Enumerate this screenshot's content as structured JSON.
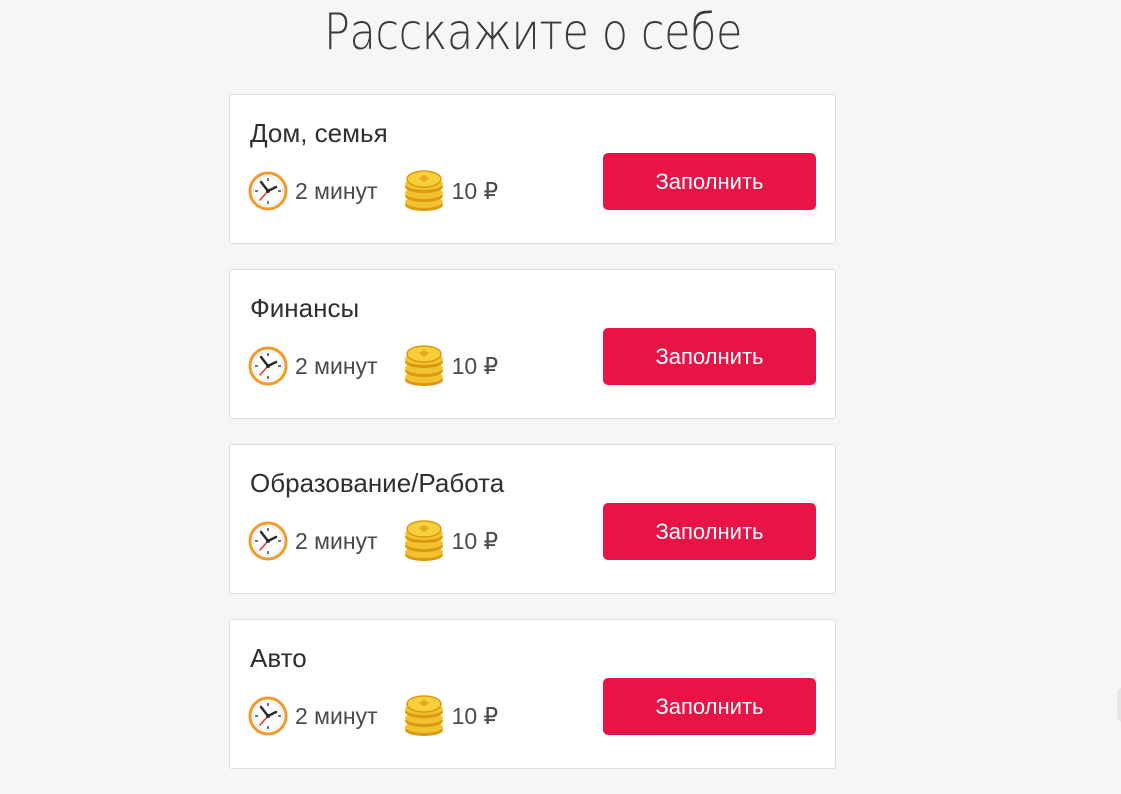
{
  "page": {
    "title": "Расскажите о себе"
  },
  "cards": [
    {
      "title": "Дом, семья",
      "duration": "2 минут",
      "reward": "10 ₽",
      "button_label": "Заполнить"
    },
    {
      "title": "Финансы",
      "duration": "2 минут",
      "reward": "10 ₽",
      "button_label": "Заполнить"
    },
    {
      "title": "Образование/Работа",
      "duration": "2 минут",
      "reward": "10 ₽",
      "button_label": "Заполнить"
    },
    {
      "title": "Авто",
      "duration": "2 минут",
      "reward": "10 ₽",
      "button_label": "Заполнить"
    }
  ],
  "icons": {
    "duration": "clock-icon",
    "reward": "coins-icon"
  },
  "colors": {
    "accent": "#ea1346",
    "clock_ring": "#f39a2c",
    "coin": "#f2c22e",
    "background": "#f6f6f8"
  }
}
